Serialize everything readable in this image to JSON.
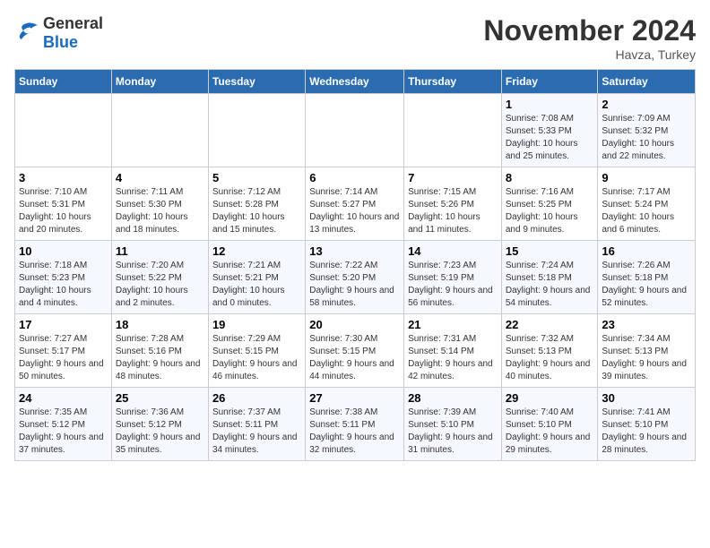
{
  "logo": {
    "general": "General",
    "blue": "Blue"
  },
  "title": "November 2024",
  "subtitle": "Havza, Turkey",
  "days_header": [
    "Sunday",
    "Monday",
    "Tuesday",
    "Wednesday",
    "Thursday",
    "Friday",
    "Saturday"
  ],
  "weeks": [
    [
      {
        "day": "",
        "info": ""
      },
      {
        "day": "",
        "info": ""
      },
      {
        "day": "",
        "info": ""
      },
      {
        "day": "",
        "info": ""
      },
      {
        "day": "",
        "info": ""
      },
      {
        "day": "1",
        "info": "Sunrise: 7:08 AM\nSunset: 5:33 PM\nDaylight: 10 hours and 25 minutes."
      },
      {
        "day": "2",
        "info": "Sunrise: 7:09 AM\nSunset: 5:32 PM\nDaylight: 10 hours and 22 minutes."
      }
    ],
    [
      {
        "day": "3",
        "info": "Sunrise: 7:10 AM\nSunset: 5:31 PM\nDaylight: 10 hours and 20 minutes."
      },
      {
        "day": "4",
        "info": "Sunrise: 7:11 AM\nSunset: 5:30 PM\nDaylight: 10 hours and 18 minutes."
      },
      {
        "day": "5",
        "info": "Sunrise: 7:12 AM\nSunset: 5:28 PM\nDaylight: 10 hours and 15 minutes."
      },
      {
        "day": "6",
        "info": "Sunrise: 7:14 AM\nSunset: 5:27 PM\nDaylight: 10 hours and 13 minutes."
      },
      {
        "day": "7",
        "info": "Sunrise: 7:15 AM\nSunset: 5:26 PM\nDaylight: 10 hours and 11 minutes."
      },
      {
        "day": "8",
        "info": "Sunrise: 7:16 AM\nSunset: 5:25 PM\nDaylight: 10 hours and 9 minutes."
      },
      {
        "day": "9",
        "info": "Sunrise: 7:17 AM\nSunset: 5:24 PM\nDaylight: 10 hours and 6 minutes."
      }
    ],
    [
      {
        "day": "10",
        "info": "Sunrise: 7:18 AM\nSunset: 5:23 PM\nDaylight: 10 hours and 4 minutes."
      },
      {
        "day": "11",
        "info": "Sunrise: 7:20 AM\nSunset: 5:22 PM\nDaylight: 10 hours and 2 minutes."
      },
      {
        "day": "12",
        "info": "Sunrise: 7:21 AM\nSunset: 5:21 PM\nDaylight: 10 hours and 0 minutes."
      },
      {
        "day": "13",
        "info": "Sunrise: 7:22 AM\nSunset: 5:20 PM\nDaylight: 9 hours and 58 minutes."
      },
      {
        "day": "14",
        "info": "Sunrise: 7:23 AM\nSunset: 5:19 PM\nDaylight: 9 hours and 56 minutes."
      },
      {
        "day": "15",
        "info": "Sunrise: 7:24 AM\nSunset: 5:18 PM\nDaylight: 9 hours and 54 minutes."
      },
      {
        "day": "16",
        "info": "Sunrise: 7:26 AM\nSunset: 5:18 PM\nDaylight: 9 hours and 52 minutes."
      }
    ],
    [
      {
        "day": "17",
        "info": "Sunrise: 7:27 AM\nSunset: 5:17 PM\nDaylight: 9 hours and 50 minutes."
      },
      {
        "day": "18",
        "info": "Sunrise: 7:28 AM\nSunset: 5:16 PM\nDaylight: 9 hours and 48 minutes."
      },
      {
        "day": "19",
        "info": "Sunrise: 7:29 AM\nSunset: 5:15 PM\nDaylight: 9 hours and 46 minutes."
      },
      {
        "day": "20",
        "info": "Sunrise: 7:30 AM\nSunset: 5:15 PM\nDaylight: 9 hours and 44 minutes."
      },
      {
        "day": "21",
        "info": "Sunrise: 7:31 AM\nSunset: 5:14 PM\nDaylight: 9 hours and 42 minutes."
      },
      {
        "day": "22",
        "info": "Sunrise: 7:32 AM\nSunset: 5:13 PM\nDaylight: 9 hours and 40 minutes."
      },
      {
        "day": "23",
        "info": "Sunrise: 7:34 AM\nSunset: 5:13 PM\nDaylight: 9 hours and 39 minutes."
      }
    ],
    [
      {
        "day": "24",
        "info": "Sunrise: 7:35 AM\nSunset: 5:12 PM\nDaylight: 9 hours and 37 minutes."
      },
      {
        "day": "25",
        "info": "Sunrise: 7:36 AM\nSunset: 5:12 PM\nDaylight: 9 hours and 35 minutes."
      },
      {
        "day": "26",
        "info": "Sunrise: 7:37 AM\nSunset: 5:11 PM\nDaylight: 9 hours and 34 minutes."
      },
      {
        "day": "27",
        "info": "Sunrise: 7:38 AM\nSunset: 5:11 PM\nDaylight: 9 hours and 32 minutes."
      },
      {
        "day": "28",
        "info": "Sunrise: 7:39 AM\nSunset: 5:10 PM\nDaylight: 9 hours and 31 minutes."
      },
      {
        "day": "29",
        "info": "Sunrise: 7:40 AM\nSunset: 5:10 PM\nDaylight: 9 hours and 29 minutes."
      },
      {
        "day": "30",
        "info": "Sunrise: 7:41 AM\nSunset: 5:10 PM\nDaylight: 9 hours and 28 minutes."
      }
    ]
  ]
}
